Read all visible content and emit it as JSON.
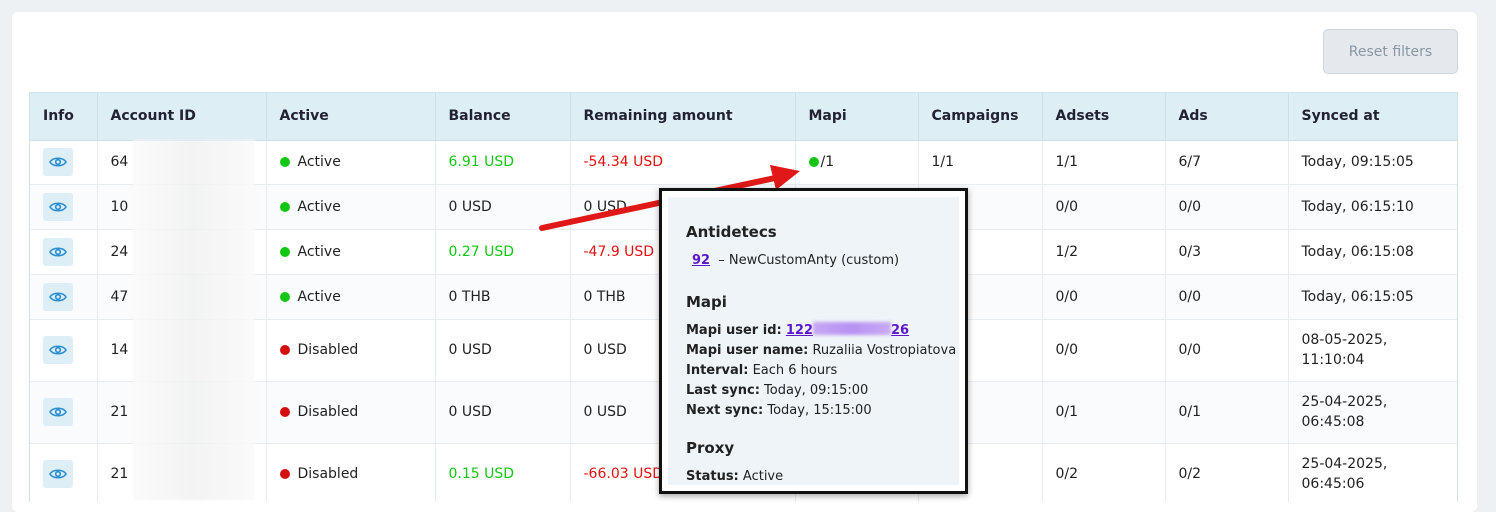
{
  "toolbar": {
    "reset_label": "Reset filters"
  },
  "table": {
    "headers": [
      "Info",
      "Account ID",
      "Active",
      "Balance",
      "Remaining amount",
      "Mapi",
      "Campaigns",
      "Adsets",
      "Ads",
      "Synced at"
    ],
    "rows": [
      {
        "account_prefix": "64",
        "status": "Active",
        "balance": "6.91 USD",
        "remaining": "-54.34 USD",
        "mapi": "/1",
        "campaigns": "1/1",
        "adsets": "1/1",
        "ads": "6/7",
        "synced_line1": "Today, 09:15:05",
        "synced_line2": ""
      },
      {
        "account_prefix": "10",
        "status": "Active",
        "balance": "0 USD",
        "remaining": "0 USD",
        "mapi": "",
        "campaigns": "",
        "adsets": "0/0",
        "ads": "0/0",
        "synced_line1": "Today, 06:15:10",
        "synced_line2": ""
      },
      {
        "account_prefix": "24",
        "status": "Active",
        "balance": "0.27 USD",
        "remaining": "-47.9 USD",
        "mapi": "",
        "campaigns": "",
        "adsets": "1/2",
        "ads": "0/3",
        "synced_line1": "Today, 06:15:08",
        "synced_line2": ""
      },
      {
        "account_prefix": "47",
        "status": "Active",
        "balance": "0 THB",
        "remaining": "0 THB",
        "mapi": "",
        "campaigns": "",
        "adsets": "0/0",
        "ads": "0/0",
        "synced_line1": "Today, 06:15:05",
        "synced_line2": ""
      },
      {
        "account_prefix": "14",
        "status": "Disabled",
        "balance": "0 USD",
        "remaining": "0 USD",
        "mapi": "",
        "campaigns": "",
        "adsets": "0/0",
        "ads": "0/0",
        "synced_line1": "08-05-2025,",
        "synced_line2": "11:10:04"
      },
      {
        "account_prefix": "21",
        "status": "Disabled",
        "balance": "0 USD",
        "remaining": "0 USD",
        "mapi": "",
        "campaigns": "",
        "adsets": "0/1",
        "ads": "0/1",
        "synced_line1": "25-04-2025,",
        "synced_line2": "06:45:08"
      },
      {
        "account_prefix": "21",
        "status": "Disabled",
        "balance": "0.15 USD",
        "remaining": "-66.03 USD",
        "mapi": "",
        "campaigns": "",
        "adsets": "0/2",
        "ads": "0/2",
        "synced_line1": "25-04-2025,",
        "synced_line2": "06:45:06"
      }
    ]
  },
  "popover": {
    "antidetect_title": "Antidetecs",
    "antidetect_id": "92",
    "antidetect_desc": "– NewCustomAnty (custom)",
    "mapi_title": "Mapi",
    "mapi_user_id_label": "Mapi user id:",
    "mapi_user_id_prefix": "122",
    "mapi_user_id_suffix": "26",
    "mapi_user_name_label": "Mapi user name:",
    "mapi_user_name": "Ruzaliia Vostropiatova",
    "interval_label": "Interval:",
    "interval": "Each 6 hours",
    "last_sync_label": "Last sync:",
    "last_sync": "Today, 09:15:00",
    "next_sync_label": "Next sync:",
    "next_sync": "Today, 15:15:00",
    "proxy_title": "Proxy",
    "proxy_status_label": "Status:",
    "proxy_status": "Active"
  },
  "colors": {
    "active_dot": "#13c613",
    "disabled_dot": "#d10f0f",
    "positive": "#13c613",
    "negative": "#e31010",
    "header_bg": "#ddeef5",
    "arrow": "#e01818"
  }
}
